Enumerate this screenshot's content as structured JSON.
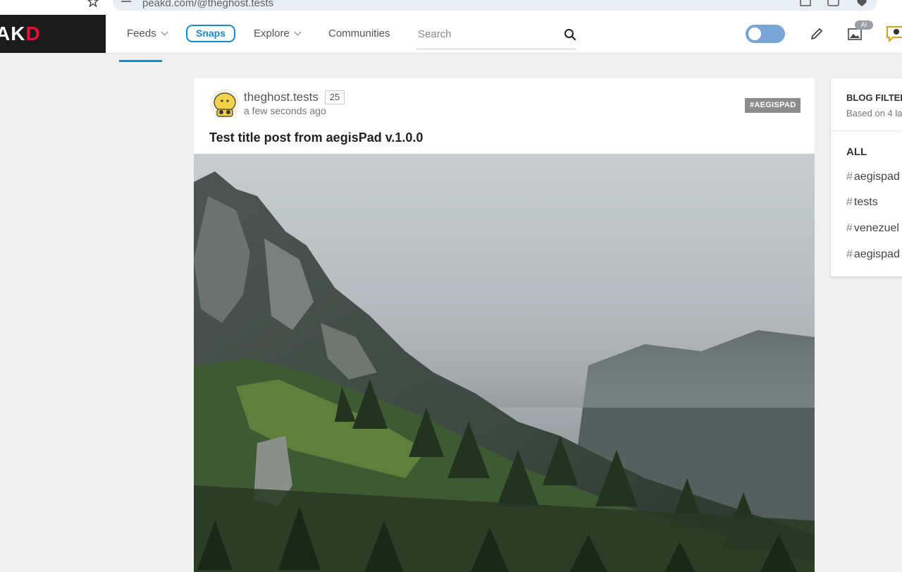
{
  "browser": {
    "url": "peakd.com/@theghost.tests"
  },
  "header": {
    "logo": {
      "main": "AK",
      "accent": "D"
    },
    "nav": {
      "feeds": "Feeds",
      "snaps": "Snaps",
      "explore": "Explore",
      "communities": "Communities"
    },
    "search": {
      "placeholder": "Search"
    },
    "ai_badge": "AI"
  },
  "post": {
    "author": "theghost.tests",
    "reputation": "25",
    "time": "a few seconds ago",
    "tag": "#AEGISPAD",
    "title": "Test title post from aegisPad v.1.0.0"
  },
  "filter": {
    "title": "BLOG FILTER",
    "subtitle": "Based on 4 la",
    "all": "ALL",
    "tags": [
      {
        "hash": "#",
        "name": "aegispad"
      },
      {
        "hash": "#",
        "name": "tests"
      },
      {
        "hash": "#",
        "name": "venezuel"
      },
      {
        "hash": "#",
        "name": "aegispad"
      }
    ]
  },
  "colors": {
    "accent": "#1a89c9",
    "brand_red": "#e31337",
    "toggle": "#7aa6d6"
  }
}
